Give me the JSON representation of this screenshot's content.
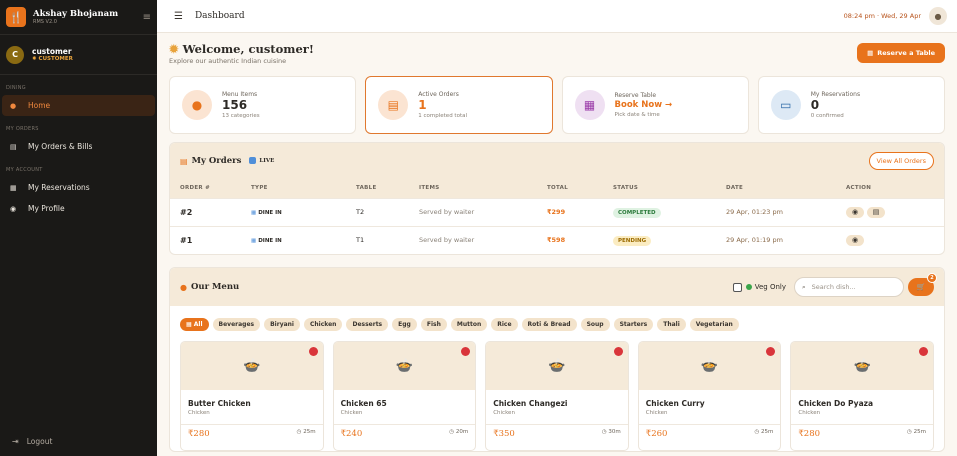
{
  "app": {
    "name": "Akshay Bhojanam",
    "version": "RMS V2.0"
  },
  "user": {
    "initial": "C",
    "name": "customer",
    "role": "CUSTOMER"
  },
  "sidebar": {
    "sections": [
      "DINING",
      "MY ORDERS",
      "MY ACCOUNT"
    ],
    "items": [
      {
        "label": "Home"
      },
      {
        "label": "My Orders & Bills"
      },
      {
        "label": "My Reservations"
      },
      {
        "label": "My Profile"
      }
    ],
    "logout": "Logout"
  },
  "topbar": {
    "title": "Dashboard",
    "clock": "08:24 pm · Wed, 29 Apr"
  },
  "welcome": {
    "title": "Welcome, customer!",
    "subtitle": "Explore our authentic Indian cuisine",
    "reserve_button": "Reserve a Table"
  },
  "stats": [
    {
      "label": "Menu Items",
      "value": "156",
      "note": "13 categories"
    },
    {
      "label": "Active Orders",
      "value": "1",
      "note": "1 completed total"
    },
    {
      "label": "Reserve Table",
      "value": "Book Now →",
      "note": "Pick date & time"
    },
    {
      "label": "My Reservations",
      "value": "0",
      "note": "0 confirmed"
    }
  ],
  "orders": {
    "title": "My Orders",
    "live": "LIVE",
    "view_all": "View All Orders",
    "columns": [
      "ORDER #",
      "TYPE",
      "TABLE",
      "ITEMS",
      "TOTAL",
      "STATUS",
      "DATE",
      "ACTION"
    ],
    "rows": [
      {
        "order": "#2",
        "type": "DINE IN",
        "table": "T2",
        "items": "Served by waiter",
        "total": "₹299",
        "status": "COMPLETED",
        "date": "29 Apr, 01:23 pm"
      },
      {
        "order": "#1",
        "type": "DINE IN",
        "table": "T1",
        "items": "Served by waiter",
        "total": "₹598",
        "status": "PENDING",
        "date": "29 Apr, 01:19 pm"
      }
    ]
  },
  "menu": {
    "title": "Our Menu",
    "veg_only": "Veg Only",
    "search_placeholder": "Search dish...",
    "cart_count": "2",
    "categories": [
      "All",
      "Beverages",
      "Biryani",
      "Chicken",
      "Desserts",
      "Egg",
      "Fish",
      "Mutton",
      "Rice",
      "Roti & Bread",
      "Soup",
      "Starters",
      "Thali",
      "Vegetarian"
    ],
    "dishes": [
      {
        "name": "Butter Chicken",
        "category": "Chicken",
        "price": "₹280",
        "time": "25m"
      },
      {
        "name": "Chicken 65",
        "category": "Chicken",
        "price": "₹240",
        "time": "20m"
      },
      {
        "name": "Chicken Changezi",
        "category": "Chicken",
        "price": "₹350",
        "time": "30m"
      },
      {
        "name": "Chicken Curry",
        "category": "Chicken",
        "price": "₹260",
        "time": "25m"
      },
      {
        "name": "Chicken Do Pyaza",
        "category": "Chicken",
        "price": "₹280",
        "time": "25m"
      }
    ]
  },
  "colors": {
    "accent": "#e8731c",
    "sidebar_bg": "#1a1917",
    "veg": "#3aa54a",
    "nonveg": "#d9353b"
  }
}
